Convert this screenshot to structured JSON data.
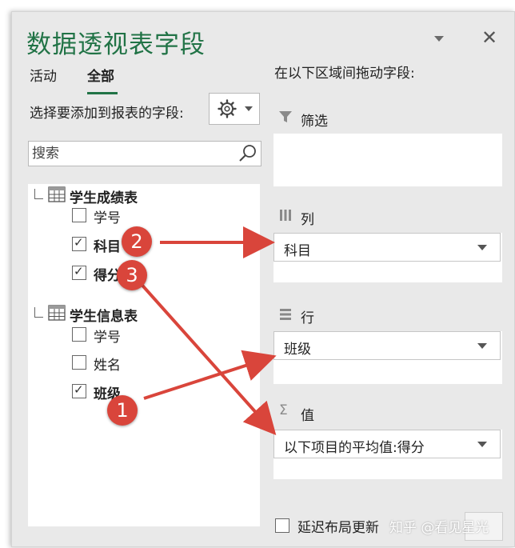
{
  "panel": {
    "title": "数据透视表字段",
    "close_glyph": "✕"
  },
  "tabs": [
    {
      "label": "活动",
      "active": false
    },
    {
      "label": "全部",
      "active": true
    }
  ],
  "left": {
    "instruction": "选择要添加到报表的字段:",
    "search_placeholder": "搜索",
    "tables": [
      {
        "name": "学生成绩表",
        "fields": [
          {
            "label": "学号",
            "checked": false
          },
          {
            "label": "科目",
            "checked": true
          },
          {
            "label": "得分",
            "checked": true
          }
        ]
      },
      {
        "name": "学生信息表",
        "fields": [
          {
            "label": "学号",
            "checked": false
          },
          {
            "label": "姓名",
            "checked": false
          },
          {
            "label": "班级",
            "checked": true
          }
        ]
      }
    ]
  },
  "right": {
    "instruction": "在以下区域间拖动字段:",
    "areas": {
      "filter": {
        "label": "筛选"
      },
      "columns": {
        "label": "列",
        "item": "科目"
      },
      "rows": {
        "label": "行",
        "item": "班级"
      },
      "values": {
        "label": "值",
        "icon": "Σ",
        "item": "以下项目的平均值:得分"
      }
    }
  },
  "footer": {
    "defer_label": "延迟布局更新",
    "watermark": "知乎 @看见星光"
  },
  "annotations": {
    "badges": [
      "1",
      "2",
      "3"
    ],
    "color": "#d9453b"
  }
}
